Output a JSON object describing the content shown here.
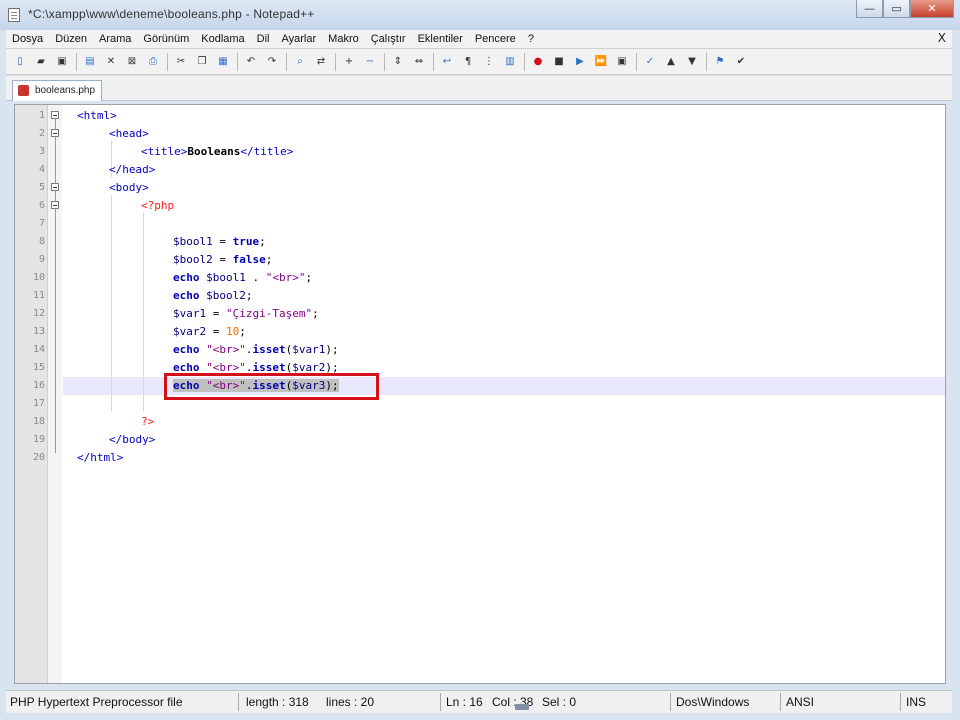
{
  "window": {
    "title": "*C:\\xampp\\www\\deneme\\booleans.php - Notepad++",
    "minimize": "—",
    "maximize": "▭",
    "close": "✕"
  },
  "menu": {
    "items": [
      "Dosya",
      "Düzen",
      "Arama",
      "Görünüm",
      "Kodlama",
      "Dil",
      "Ayarlar",
      "Makro",
      "Çalıştır",
      "Eklentiler",
      "Pencere",
      "?"
    ],
    "close": "X"
  },
  "toolbar": {
    "buttons": [
      "new-file-icon",
      "open-file-icon",
      "save-icon",
      "save-all-icon",
      "close-icon",
      "close-all-icon",
      "print-icon",
      "cut-icon",
      "copy-icon",
      "paste-icon",
      "undo-icon",
      "redo-icon",
      "find-icon",
      "replace-icon",
      "zoom-in-icon",
      "zoom-out-icon",
      "sync-v-icon",
      "sync-h-icon",
      "wrap-icon",
      "all-chars-icon",
      "indent-guide-icon",
      "doc-map-icon",
      "record-macro-icon",
      "stop-macro-icon",
      "play-macro-icon",
      "run-macro-icon",
      "save-macro-icon",
      "spellcheck-icon",
      "bookmark-up-icon",
      "bookmark-down-icon",
      "launch-icon",
      "check-icon"
    ],
    "colors": {
      "record": "#d4101a",
      "accent": "#2f6fc3"
    }
  },
  "tabs": [
    {
      "label": "booleans.php",
      "icon": "php-file-icon",
      "color": "#c9352b"
    }
  ],
  "editor": {
    "line_numbers": [
      "1",
      "2",
      "3",
      "4",
      "5",
      "6",
      "7",
      "8",
      "9",
      "10",
      "11",
      "12",
      "13",
      "14",
      "15",
      "16",
      "17",
      "18",
      "19",
      "20"
    ],
    "current_line": 16
  },
  "status": {
    "file_type": "PHP Hypertext Preprocessor file",
    "length": "length : 318",
    "lines": "lines : 20",
    "ln": "Ln : 16",
    "col": "Col : 38",
    "sel": "Sel : 0",
    "eol": "Dos\\Windows",
    "encoding": "ANSI",
    "mode": "INS"
  }
}
